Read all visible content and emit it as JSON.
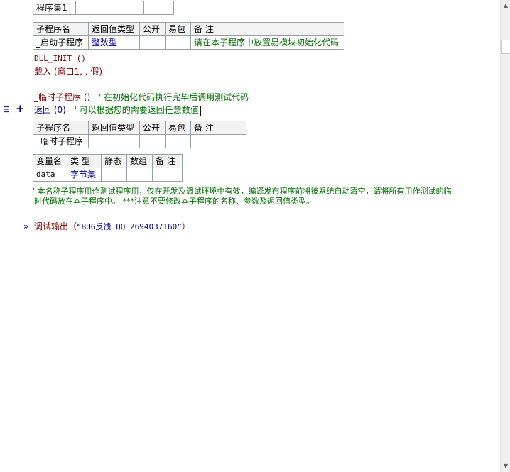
{
  "assembly_table": {
    "name": "程序集1",
    "extra_cells": [
      "",
      "",
      "",
      ""
    ]
  },
  "startup_sub": {
    "headers": [
      "子程序名",
      "返回值类型",
      "公开",
      "易包",
      "备 注"
    ],
    "row": {
      "name": "_启动子程序",
      "return_type": "整数型",
      "public": "",
      "easy_pkg": "",
      "remark": "请在本子程序中放置易模块初始化代码"
    }
  },
  "startup_code": {
    "line1": "DLL_INIT ()",
    "line2": "载入 (窗口1, , 假)",
    "line3_call": "_临时子程序 ()",
    "line3_comment": "' 在初始化代码执行完毕后调用测试代码",
    "line4_kw": "返回 (0)",
    "line4_comment": "' 可以根据您的需要返回任意数值"
  },
  "gutter": {
    "collapse_marker": "⊟",
    "plus": "+",
    "arrow": "»"
  },
  "temp_sub": {
    "headers": [
      "子程序名",
      "返回值类型",
      "公开",
      "易包",
      "备 注"
    ],
    "row": {
      "name": "_临时子程序",
      "return_type": "",
      "public": "",
      "easy_pkg": "",
      "remark": ""
    }
  },
  "var_table": {
    "headers": [
      "变量名",
      "类 型",
      "静态",
      "数组",
      "备 注"
    ],
    "row": {
      "name": "data",
      "type": "字节集",
      "static": "",
      "array": "",
      "remark": ""
    }
  },
  "temp_comment": {
    "line1": "' 本名称子程序用作测试程序用，仅在开发及调试环境中有效，编译发布程序前将被系统自动清空，请将所有用作测试的临",
    "line2": "时代码放在本子程序中。 ***注意不要修改本子程序的名称、参数及返回值类型。"
  },
  "debug_line": {
    "func": "调试输出",
    "open": "（",
    "arg": "“BUG反馈 QQ 2694037160”",
    "close": "）"
  },
  "scrollbar": {
    "up": "▲",
    "down": "▼"
  }
}
